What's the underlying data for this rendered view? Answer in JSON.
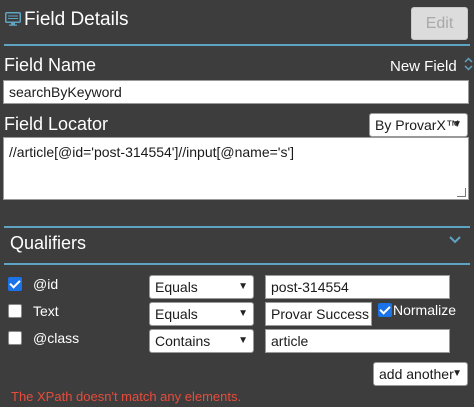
{
  "header": {
    "title": "Field Details",
    "edit_label": "Edit"
  },
  "field_name": {
    "label": "Field Name",
    "new_field_label": "New Field",
    "value": "searchByKeyword"
  },
  "field_locator": {
    "label": "Field Locator",
    "dropdown_value": "By ProvarX™",
    "value": "//article[@id='post-314554']//input[@name='s']"
  },
  "qualifiers": {
    "title": "Qualifiers",
    "rows": [
      {
        "checked": true,
        "label": "@id",
        "operator": "Equals",
        "value": "post-314554"
      },
      {
        "checked": false,
        "label": "Text",
        "operator": "Equals",
        "value": "Provar Success F"
      },
      {
        "checked": false,
        "label": "@class",
        "operator": "Contains",
        "value": "article"
      }
    ],
    "normalize_label": "Normalize",
    "normalize_checked": true,
    "add_another_label": "add another"
  },
  "error_message": "The XPath doesn't match any elements.",
  "colors": {
    "background": "#3d3d3d",
    "accent": "#5fa3c2",
    "checkbox": "#1a73e8",
    "error": "#e74c3c"
  }
}
